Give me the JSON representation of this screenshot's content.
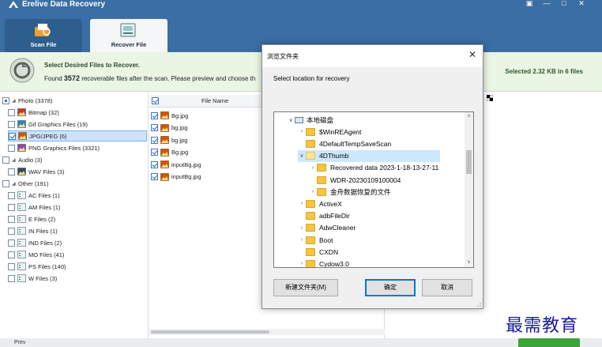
{
  "app": {
    "title": "Erelive Data Recovery"
  },
  "tabs": [
    {
      "label": "Scan File"
    },
    {
      "label": "Recover File"
    }
  ],
  "info": {
    "title": "Select Desired Files to Recover.",
    "found_prefix": "Found",
    "found_count": "3572",
    "found_suffix": "recoverable files after the scan. Please preview and choose th",
    "selected_summary": "Selected 2.32 KB in 6 files"
  },
  "tree": {
    "items": [
      {
        "label": "Photo (3378)",
        "level": 0,
        "check": "part",
        "expander": "◢"
      },
      {
        "label": "Bitmap (32)",
        "level": 1,
        "check": "off",
        "icon": "bitmap-icon",
        "color": "#c0392b"
      },
      {
        "label": "Gif Graphics Files (19)",
        "level": 1,
        "check": "off",
        "icon": "gif-icon",
        "color": "#2e86c1"
      },
      {
        "label": "JPG/JPEG (6)",
        "level": 1,
        "check": "on",
        "icon": "jpg-icon",
        "color": "#d35400",
        "selected": true
      },
      {
        "label": "PNG Graphics Files (3321)",
        "level": 1,
        "check": "off",
        "icon": "png-icon",
        "color": "#8e44ad"
      },
      {
        "label": "Audio (3)",
        "level": 0,
        "check": "off",
        "expander": "◢"
      },
      {
        "label": "WAV Files (3)",
        "level": 1,
        "check": "off",
        "icon": "wav-icon",
        "color": "#34495e"
      },
      {
        "label": "Other (191)",
        "level": 0,
        "check": "off",
        "expander": "◢"
      },
      {
        "label": "AC Files (1)",
        "level": 1,
        "check": "off",
        "icon": "file-icon"
      },
      {
        "label": "AM Files (1)",
        "level": 1,
        "check": "off",
        "icon": "file-icon"
      },
      {
        "label": "E Files (2)",
        "level": 1,
        "check": "off",
        "icon": "file-icon"
      },
      {
        "label": "IN Files (1)",
        "level": 1,
        "check": "off",
        "icon": "file-icon"
      },
      {
        "label": "IND Files (2)",
        "level": 1,
        "check": "off",
        "icon": "file-icon"
      },
      {
        "label": "MO Files (41)",
        "level": 1,
        "check": "off",
        "icon": "file-icon"
      },
      {
        "label": "PS Files (140)",
        "level": 1,
        "check": "off",
        "icon": "file-icon"
      },
      {
        "label": "W Files (3)",
        "level": 1,
        "check": "off",
        "icon": "file-icon"
      }
    ]
  },
  "filelist": {
    "header": "File Name",
    "rows": [
      "Bg.jpg",
      "bg.jpg",
      "bg.jpg",
      "Bg.jpg",
      "inputBg.jpg",
      "inputBg.jpg"
    ]
  },
  "bottom": {
    "prev_label": "Prev"
  },
  "watermark": "最需教育",
  "dialog": {
    "title": "浏览文件夹",
    "close": "✕",
    "prompt": "Select location for recovery",
    "tree": [
      {
        "label": "本地磁盘",
        "indent": 0,
        "chevron": "∨",
        "type": "drive"
      },
      {
        "label": "$WinREAgent",
        "indent": 1,
        "chevron": "›",
        "type": "folder"
      },
      {
        "label": "4DefaultTempSaveScan",
        "indent": 1,
        "chevron": "",
        "type": "folder"
      },
      {
        "label": "4DThumb",
        "indent": 1,
        "chevron": "∨",
        "type": "folder-light",
        "selected": true
      },
      {
        "label": "Recovered data 2023-1-18-13-27-11",
        "indent": 2,
        "chevron": "›",
        "type": "folder"
      },
      {
        "label": "WDR-20230109100004",
        "indent": 2,
        "chevron": "",
        "type": "folder"
      },
      {
        "label": "金舟数据恢复的文件",
        "indent": 2,
        "chevron": "›",
        "type": "folder"
      },
      {
        "label": "ActiveX",
        "indent": 1,
        "chevron": "›",
        "type": "folder"
      },
      {
        "label": "adbFileDir",
        "indent": 1,
        "chevron": "",
        "type": "folder"
      },
      {
        "label": "AdwCleaner",
        "indent": 1,
        "chevron": "›",
        "type": "folder"
      },
      {
        "label": "Boot",
        "indent": 1,
        "chevron": "›",
        "type": "folder"
      },
      {
        "label": "CXDN",
        "indent": 1,
        "chevron": "",
        "type": "folder"
      },
      {
        "label": "Cydow3.0",
        "indent": 1,
        "chevron": "›",
        "type": "folder"
      }
    ],
    "buttons": {
      "new_folder": "新建文件夹(M)",
      "ok": "确定",
      "cancel": "取消"
    }
  },
  "colors": {
    "titlebar": "#3a6ea5",
    "infobar": "#eaf5e4",
    "selection": "#cde3fb",
    "recover_button": "#3aa33a",
    "watermark": "#1a1aa0"
  }
}
